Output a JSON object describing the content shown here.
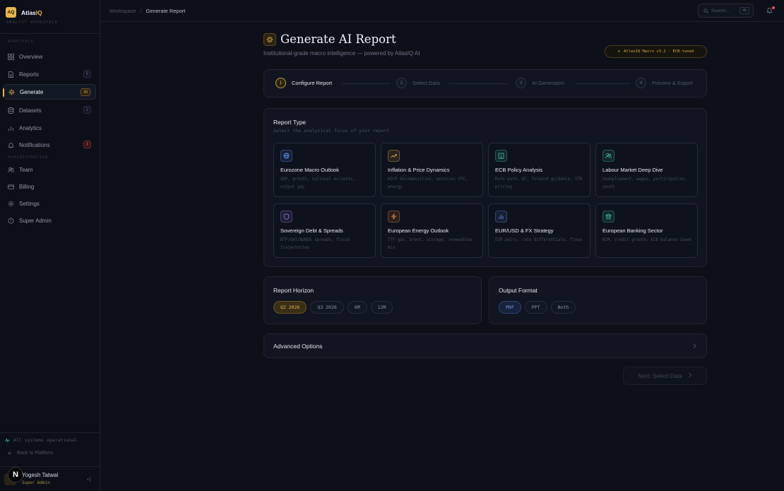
{
  "brand": {
    "logo": "AQ",
    "name_main": "Atlas",
    "name_accent": "IQ",
    "subtitle": "ANALYST WORKSPACE"
  },
  "sidebar": {
    "section_workspace": "WORKSPACE",
    "section_admin": "ADMINISTRATION",
    "items": [
      {
        "label": "Overview",
        "icon": "grid-icon"
      },
      {
        "label": "Reports",
        "icon": "document-icon",
        "badge": "5"
      },
      {
        "label": "Generate",
        "icon": "sparkle-icon",
        "badge": "AI"
      },
      {
        "label": "Datasets",
        "icon": "database-icon",
        "badge": "2"
      },
      {
        "label": "Analytics",
        "icon": "bar-chart-icon"
      },
      {
        "label": "Notifications",
        "icon": "bell-icon",
        "badge": "3"
      },
      {
        "label": "Team",
        "icon": "users-icon"
      },
      {
        "label": "Billing",
        "icon": "credit-card-icon"
      },
      {
        "label": "Settings",
        "icon": "gear-icon"
      },
      {
        "label": "Super Admin",
        "icon": "shield-icon"
      }
    ],
    "status": "All systems operational",
    "back": "Back to Platform",
    "user": {
      "name": "Yogesh Tatwal",
      "role": "Super Admin",
      "overlay": "N"
    }
  },
  "topbar": {
    "crumb_root": "Workspace",
    "crumb_current": "Generate Report",
    "search_placeholder": "Search...",
    "search_shortcut": "⌘K"
  },
  "hero": {
    "title": "Generate AI Report",
    "subtitle": "Institutional-grade macro intelligence — powered by AtlasIQ AI",
    "model": "AtlasIQ Macro v3.2 · ECB-tuned"
  },
  "steps": [
    {
      "num": "1",
      "label": "Configure Report",
      "active": true
    },
    {
      "num": "2",
      "label": "Select Data"
    },
    {
      "num": "3",
      "label": "AI Generation"
    },
    {
      "num": "4",
      "label": "Preview & Export"
    }
  ],
  "report_type": {
    "title": "Report Type",
    "subtitle": "Select the analytical focus of your report",
    "tiles": [
      {
        "title": "Eurozone Macro Outlook",
        "desc": "GDP, growth, national accounts, output gap",
        "icon": "globe-icon",
        "color": "#5b8def"
      },
      {
        "title": "Inflation & Price Dynamics",
        "desc": "HICP decomposition, services CPI, energy",
        "icon": "trending-up-icon",
        "color": "#e8b54a"
      },
      {
        "title": "ECB Policy Analysis",
        "desc": "Rate path, QT, forward guidance, STR pricing",
        "icon": "bank-building-icon",
        "color": "#3fbf9f"
      },
      {
        "title": "Labour Market Deep Dive",
        "desc": "Unemployment, wages, participation, youth",
        "icon": "users-icon",
        "color": "#3fbf9f"
      },
      {
        "title": "Sovereign Debt & Spreads",
        "desc": "BTP/OAT/BONOS spreads, fiscal trajectories",
        "icon": "shield-icon",
        "color": "#9a7bea"
      },
      {
        "title": "European Energy Outlook",
        "desc": "TTF gas, brent, storage, renewables mix",
        "icon": "lightning-icon",
        "color": "#e8893a"
      },
      {
        "title": "EUR/USD & FX Strategy",
        "desc": "EUR pairs, rate differentials, flows",
        "icon": "bar-chart-icon",
        "color": "#5b8def"
      },
      {
        "title": "European Banking Sector",
        "desc": "NIM, credit growth, ECB balance sheet",
        "icon": "bank-icon",
        "color": "#3fbf9f"
      }
    ]
  },
  "horizon": {
    "title": "Report Horizon",
    "options": [
      "Q2 2026",
      "Q3 2026",
      "6M",
      "12M"
    ],
    "selected": "Q2 2026"
  },
  "format": {
    "title": "Output Format",
    "options": [
      "PDF",
      "PPT",
      "Both"
    ],
    "selected": "PDF"
  },
  "advanced": {
    "label": "Advanced Options"
  },
  "next_button": {
    "label": "Next: Select Data"
  }
}
